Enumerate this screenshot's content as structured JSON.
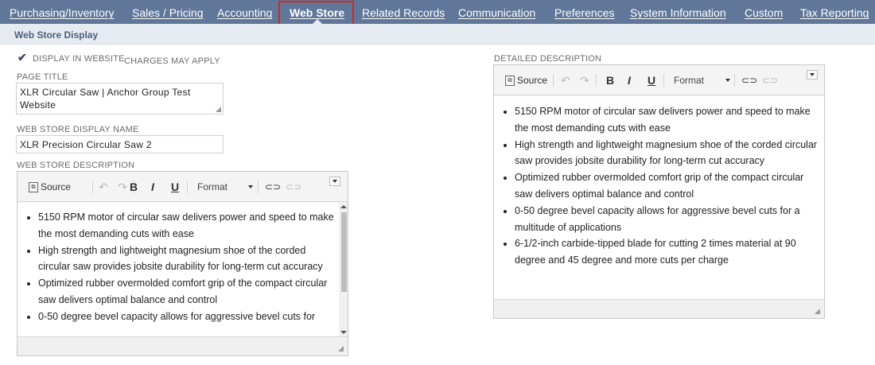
{
  "tabs": [
    {
      "label": "Purchasing/Inventory",
      "active": false
    },
    {
      "label": "Sales / Pricing",
      "active": false
    },
    {
      "label": "Accounting",
      "active": false
    },
    {
      "label": "Web Store",
      "active": true
    },
    {
      "label": "Related Records",
      "active": false
    },
    {
      "label": "Communication",
      "active": false
    },
    {
      "label": "Preferences",
      "active": false
    },
    {
      "label": "System Information",
      "active": false
    },
    {
      "label": "Custom",
      "active": false
    },
    {
      "label": "Tax Reporting",
      "active": false
    }
  ],
  "section": {
    "title": "Web Store Display"
  },
  "display_in_website": {
    "label": "DISPLAY IN WEBSITE",
    "checked": true,
    "note": "CHARGES MAY APPLY"
  },
  "page_title": {
    "label": "PAGE TITLE",
    "value": "XLR Circular Saw | Anchor Group Test Website"
  },
  "display_name": {
    "label": "WEB STORE DISPLAY NAME",
    "value": "XLR Precision Circular Saw 2"
  },
  "web_store_description": {
    "label": "WEB STORE DESCRIPTION",
    "toolbar": {
      "source": "Source",
      "bold": "B",
      "italic": "I",
      "underline": "U",
      "format": "Format"
    },
    "items": [
      "5150 RPM motor of circular saw delivers power and speed to make the most demanding cuts with ease",
      "High strength and lightweight magnesium shoe of the corded circular saw provides jobsite durability for long-term cut accuracy",
      "Optimized rubber overmolded comfort grip of the compact circular saw delivers optimal balance and control",
      "0-50 degree bevel capacity allows for aggressive bevel cuts for"
    ]
  },
  "detailed_description": {
    "label": "DETAILED DESCRIPTION",
    "toolbar": {
      "source": "Source",
      "bold": "B",
      "italic": "I",
      "underline": "U",
      "format": "Format"
    },
    "items": [
      "5150 RPM motor of circular saw delivers power and speed to make the most demanding cuts with ease",
      "High strength and lightweight magnesium shoe of the corded circular saw provides jobsite durability for long-term cut accuracy",
      "Optimized rubber overmolded comfort grip of the compact circular saw delivers optimal balance and control",
      "0-50 degree bevel capacity allows for aggressive bevel cuts for a multitude of applications",
      "6-1/2-inch carbide-tipped blade for cutting 2 times material at 90 degree and 45 degree and more cuts per charge"
    ]
  },
  "icons": {
    "checkbox": "check-icon",
    "source": "source-icon",
    "undo": "undo-icon",
    "redo": "redo-icon",
    "link": "link-icon",
    "unlink": "unlink-icon",
    "collapse": "collapse-toolbar-icon",
    "resize": "resize-grip-icon"
  },
  "colors": {
    "tab_bar": "#607799",
    "section_header": "#e6ebf2",
    "highlight": "#d8261c"
  }
}
